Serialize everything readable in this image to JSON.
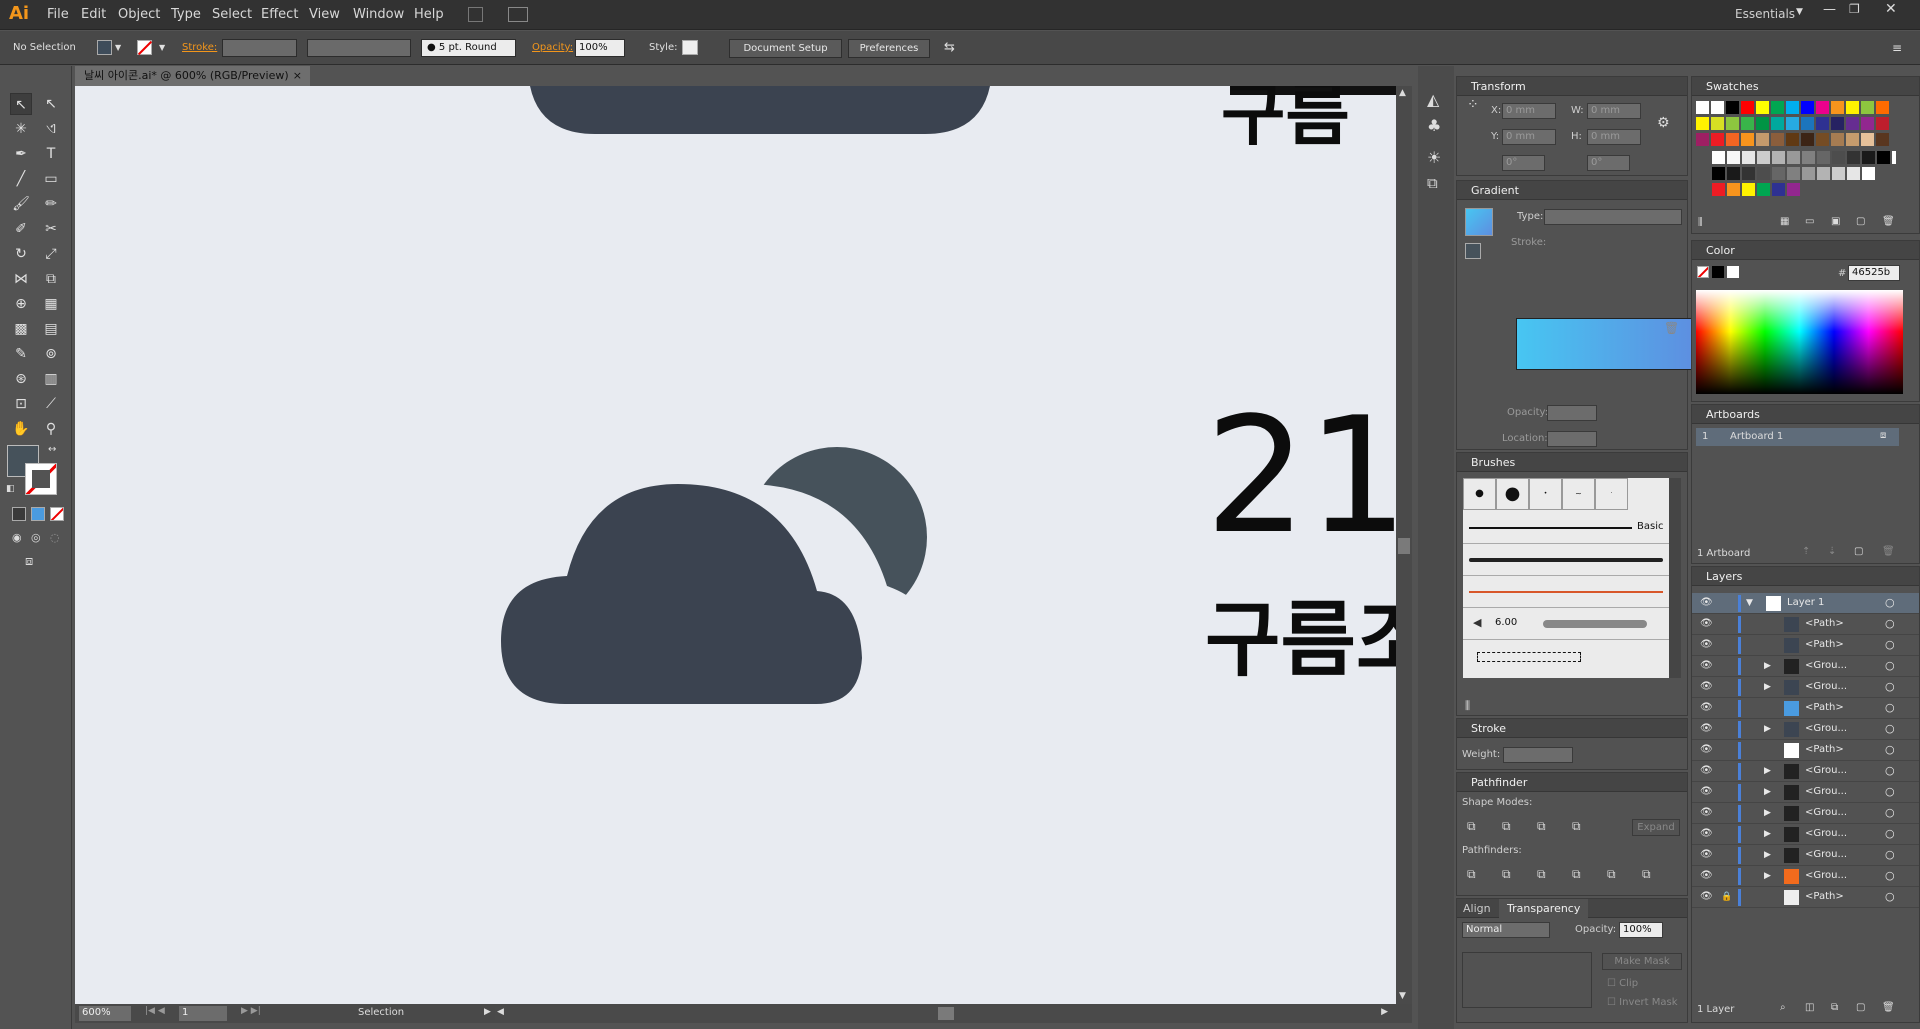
{
  "app": {
    "logo": "Ai",
    "workspace": "Essentials"
  },
  "menu": [
    "File",
    "Edit",
    "Object",
    "Type",
    "Select",
    "Effect",
    "View",
    "Window",
    "Help"
  ],
  "control": {
    "selection": "No Selection",
    "stroke_label": "Stroke:",
    "brush": "5 pt. Round",
    "opacity_label": "Opacity:",
    "opacity": "100%",
    "style_label": "Style:",
    "doc_setup": "Document Setup",
    "preferences": "Preferences"
  },
  "document": {
    "tab": "날씨 아이콘.ai* @ 600% (RGB/Preview)",
    "big_number": "21",
    "korean_text": "구름조",
    "top_text": "구름"
  },
  "status": {
    "zoom": "600%",
    "page": "1",
    "tool": "Selection"
  },
  "transform": {
    "title": "Transform",
    "x_label": "X:",
    "x": "0 mm",
    "y_label": "Y:",
    "y": "0 mm",
    "w_label": "W:",
    "w": "0 mm",
    "h_label": "H:",
    "h": "0 mm",
    "angle": "0°",
    "shear": "0°"
  },
  "gradient": {
    "title": "Gradient",
    "type_label": "Type:",
    "stroke_label": "Stroke:",
    "opacity_label": "Opacity:",
    "location_label": "Location:"
  },
  "brushes": {
    "title": "Brushes",
    "basic": "Basic",
    "size": "6.00"
  },
  "stroke": {
    "title": "Stroke",
    "weight_label": "Weight:"
  },
  "pathfinder": {
    "title": "Pathfinder",
    "shape_modes": "Shape Modes:",
    "pathfinders": "Pathfinders:",
    "expand": "Expand"
  },
  "align": {
    "title": "Align"
  },
  "transparency": {
    "title": "Transparency",
    "mode": "Normal",
    "opacity_label": "Opacity:",
    "opacity": "100%",
    "make_mask": "Make Mask",
    "clip": "Clip",
    "invert": "Invert Mask"
  },
  "swatches": {
    "title": "Swatches"
  },
  "color": {
    "title": "Color",
    "hex_label": "#",
    "hex": "46525b"
  },
  "artboards": {
    "title": "Artboards",
    "num": "1",
    "name": "Artboard 1",
    "count": "1 Artboard"
  },
  "layers": {
    "title": "Layers",
    "count": "1 Layer",
    "items": [
      {
        "name": "Layer 1",
        "expander": "▼",
        "thumb": "#ffffff"
      },
      {
        "name": "<Path>",
        "expander": "",
        "thumb": "#3c4552"
      },
      {
        "name": "<Path>",
        "expander": "",
        "thumb": "#3c4552"
      },
      {
        "name": "<Grou...",
        "expander": "▶",
        "thumb": "#222222"
      },
      {
        "name": "<Grou...",
        "expander": "▶",
        "thumb": "#3c4552"
      },
      {
        "name": "<Path>",
        "expander": "",
        "thumb": "#4a9be0"
      },
      {
        "name": "<Grou...",
        "expander": "▶",
        "thumb": "#3c4552"
      },
      {
        "name": "<Path>",
        "expander": "",
        "thumb": "#ffffff"
      },
      {
        "name": "<Grou...",
        "expander": "▶",
        "thumb": "#222222"
      },
      {
        "name": "<Grou...",
        "expander": "▶",
        "thumb": "#222222"
      },
      {
        "name": "<Grou...",
        "expander": "▶",
        "thumb": "#222222"
      },
      {
        "name": "<Grou...",
        "expander": "▶",
        "thumb": "#222222"
      },
      {
        "name": "<Grou...",
        "expander": "▶",
        "thumb": "#222222"
      },
      {
        "name": "<Grou...",
        "expander": "▶",
        "thumb": "#f26b1d"
      },
      {
        "name": "<Path>",
        "expander": "",
        "thumb": "#eeeeee"
      }
    ]
  },
  "colors": {
    "cloud": "#3b4350",
    "cloud_back": "#46525b",
    "canvas": "#e8ebf1",
    "accent": "#f3961b"
  }
}
